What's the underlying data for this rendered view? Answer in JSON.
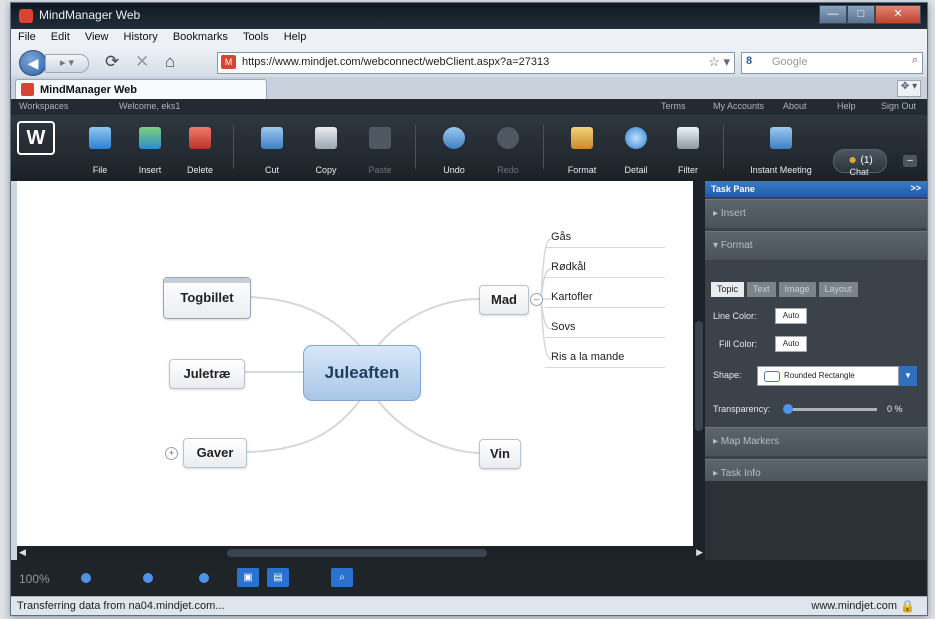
{
  "browser": {
    "title": "MindManager Web",
    "menu": [
      "File",
      "Edit",
      "View",
      "History",
      "Bookmarks",
      "Tools",
      "Help"
    ],
    "url": "https://www.mindjet.com/webconnect/webClient.aspx?a=27313",
    "search_placeholder": "Google",
    "search_engine_glyph": "8",
    "tab_label": "MindManager Web"
  },
  "app": {
    "header_left": "Workspaces",
    "header_welcome": "Welcome, eks1",
    "header_links": [
      "Terms",
      "My Accounts",
      "About",
      "Help",
      "Sign Out"
    ],
    "toolbar": {
      "file": "File",
      "insert": "Insert",
      "delete": "Delete",
      "cut": "Cut",
      "copy": "Copy",
      "paste": "Paste",
      "undo": "Undo",
      "redo": "Redo",
      "format": "Format",
      "detail": "Detail",
      "filter": "Filter",
      "instant_meeting": "Instant Meeting",
      "chat": "Chat",
      "chat_count": "(1)"
    }
  },
  "map": {
    "central": "Juleaften",
    "togbillet": "Togbillet",
    "juletrae": "Juletræ",
    "gaver": "Gaver",
    "mad": "Mad",
    "vin": "Vin",
    "mad_children": [
      "Gås",
      "Rødkål",
      "Kartofler",
      "Sovs",
      "Ris a la mande"
    ]
  },
  "taskpane": {
    "title": "Task Pane",
    "collapse_glyph": ">>",
    "insert_section": "Insert",
    "format_section": "Format",
    "tabs": [
      "Topic",
      "Text",
      "Image",
      "Layout"
    ],
    "line_color_label": "Line Color:",
    "line_color_value": "Auto",
    "fill_color_label": "Fill Color:",
    "fill_color_value": "Auto",
    "shape_label": "Shape:",
    "shape_value": "Rounded Rectangle",
    "transparency_label": "Transparency:",
    "transparency_value": "0 %",
    "map_markers_section": "Map Markers",
    "task_info_section": "Task Info"
  },
  "status": {
    "zoom": "100%",
    "left_text": "Transferring data from na04.mindjet.com...",
    "right_text": "www.mindjet.com"
  },
  "colors": {
    "accent": "#2a72cf",
    "central_fill": "#bcd5ef",
    "toolbar_bg": "#262d34"
  }
}
